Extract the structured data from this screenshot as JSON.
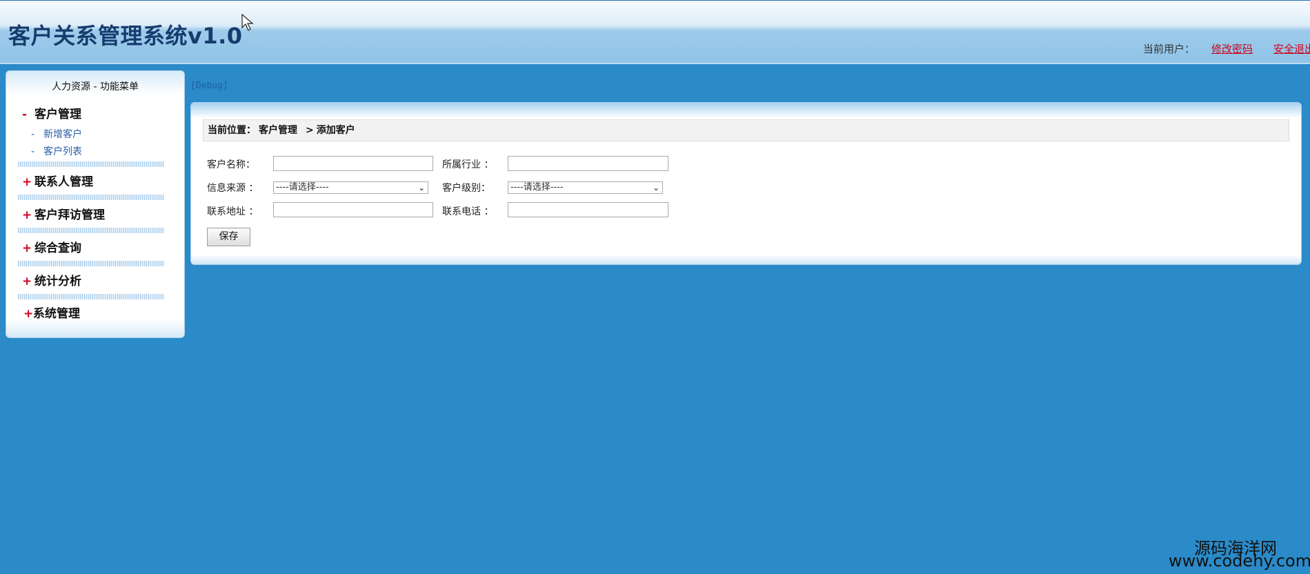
{
  "header": {
    "title": "客户关系管理系统v1.0",
    "current_user_label": "当前用户：",
    "change_password": "修改密码",
    "logout": "安全退出"
  },
  "sidebar": {
    "title": "人力资源  - 功能菜单",
    "groups": [
      {
        "sign": "-",
        "label": "客户管理",
        "items": [
          {
            "label": "新增客户"
          },
          {
            "label": "客户列表"
          }
        ]
      },
      {
        "sign": "+",
        "label": "联系人管理"
      },
      {
        "sign": "+",
        "label": "客户拜访管理"
      },
      {
        "sign": "+",
        "label": "综合查询"
      },
      {
        "sign": "+",
        "label": "统计分析"
      },
      {
        "sign": "+",
        "label": "系统管理"
      }
    ]
  },
  "debug": "[Debug]",
  "breadcrumb": {
    "label": "当前位置：",
    "section": "客户管理",
    "separator": ">",
    "page": "添加客户"
  },
  "form": {
    "customer_name_label": "客户名称：",
    "industry_label": "所属行业  ：",
    "source_label": "信息来源  ：",
    "source_value": "----请选择----",
    "level_label": "客户级别：",
    "level_value": "----请选择----",
    "address_label": "联系地址  ：",
    "phone_label": "联系电话  ：",
    "save_label": "保存"
  },
  "watermark": {
    "name": "源码海洋网",
    "url": "www.codehy.com"
  }
}
